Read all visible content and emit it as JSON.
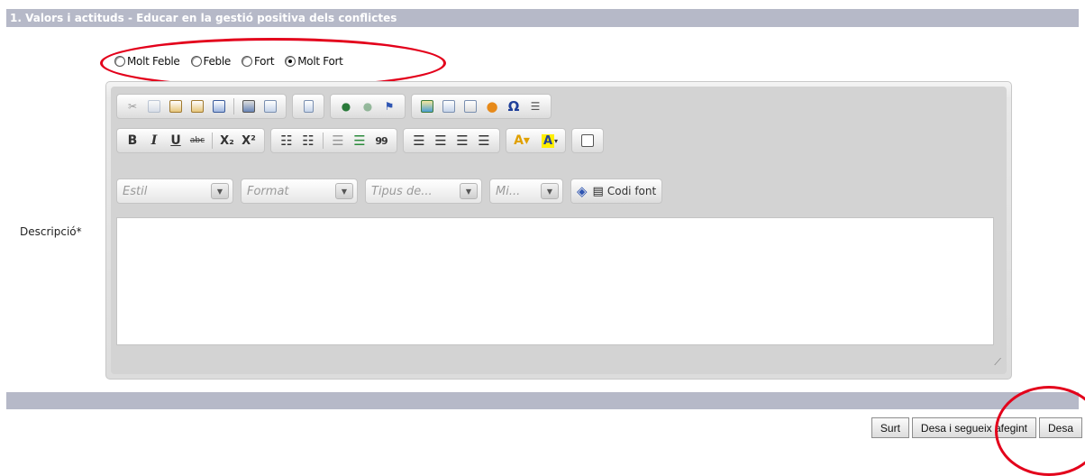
{
  "section": {
    "title": "1. Valors i actituds - Educar en la gestió positiva dels conflictes"
  },
  "rating": {
    "options": [
      {
        "label": "Molt Feble",
        "checked": false
      },
      {
        "label": "Feble",
        "checked": false
      },
      {
        "label": "Fort",
        "checked": false
      },
      {
        "label": "Molt Fort",
        "checked": true
      }
    ]
  },
  "field": {
    "label": "Descripció*",
    "value": ""
  },
  "editor": {
    "combos": [
      {
        "placeholder": "Estil"
      },
      {
        "placeholder": "Format"
      },
      {
        "placeholder": "Tipus de..."
      },
      {
        "placeholder": "Mi..."
      }
    ],
    "source_label": "Codi font",
    "bold_glyph": "B",
    "italic_glyph": "I",
    "underline_glyph": "U",
    "strike_glyph": "abc",
    "subscript_glyph": "X₂",
    "superscript_glyph": "X²",
    "omega_glyph": "Ω",
    "quote_glyph": "99"
  },
  "buttons": {
    "exit": "Surt",
    "save_continue": "Desa i segueix afegint",
    "save": "Desa"
  },
  "colors": {
    "header": "#b6b9c8",
    "annotation": "#e3001b"
  }
}
